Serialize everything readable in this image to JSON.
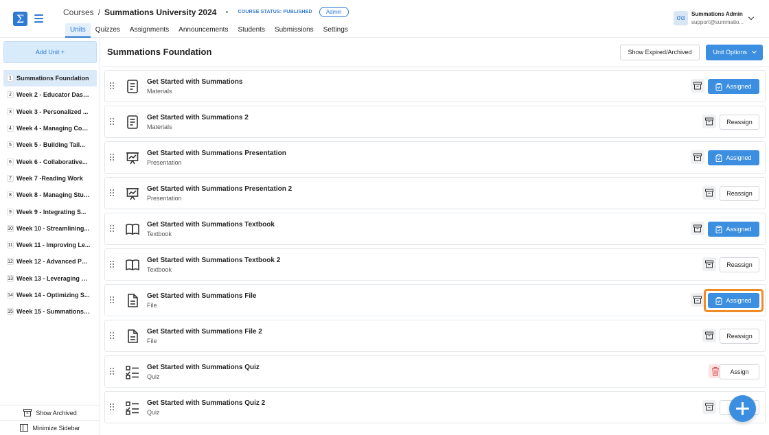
{
  "header": {
    "logo_glyph": "Σ",
    "breadcrumb_root": "Courses",
    "breadcrumb_sep": "/",
    "course_title": "Summations University 2024",
    "status": "COURSE STATUS: PUBLISHED",
    "role_badge": "Admin",
    "tabs": [
      "Units",
      "Quizzes",
      "Assignments",
      "Announcements",
      "Students",
      "Submissions",
      "Settings"
    ],
    "active_tab": "Units",
    "user": {
      "avatar": "σα",
      "name": "Summations Admin",
      "email": "support@summatio..."
    }
  },
  "sidebar": {
    "add_unit": "Add Unit +",
    "units": [
      {
        "num": "1",
        "label": "Summations Foundation"
      },
      {
        "num": "2",
        "label": "Week 2 - Educator Dash..."
      },
      {
        "num": "3",
        "label": "Week 3 - Personalized ..."
      },
      {
        "num": "4",
        "label": "Week 4 - Managing Cours..."
      },
      {
        "num": "5",
        "label": "Week 5 - Building Tail..."
      },
      {
        "num": "6",
        "label": "Week 6 - Collaborative..."
      },
      {
        "num": "7",
        "label": "Week 7 -Reading Work"
      },
      {
        "num": "8",
        "label": "Week 8 - Managing Stud..."
      },
      {
        "num": "9",
        "label": "Week 9 - Integrating S..."
      },
      {
        "num": "10",
        "label": "Week 10 - Streamlining..."
      },
      {
        "num": "11",
        "label": "Week 11 - Improving Le..."
      },
      {
        "num": "12",
        "label": "Week 12 - Advanced Per..."
      },
      {
        "num": "13",
        "label": "Week 13 - Leveraging C..."
      },
      {
        "num": "14",
        "label": "Week 14 - Optimizing S..."
      },
      {
        "num": "15",
        "label": "Week 15 - Summations i..."
      }
    ],
    "show_archived": "Show Archived",
    "minimize": "Minimize Sidebar"
  },
  "main": {
    "title": "Summations Foundation",
    "show_expired": "Show Expired/Archived",
    "unit_options": "Unit Options",
    "items": [
      {
        "title": "Get Started with Summations",
        "type": "Materials",
        "icon": "document-icon",
        "action": "Assigned"
      },
      {
        "title": "Get Started with Summations 2",
        "type": "Materials",
        "icon": "document-icon",
        "action": "Reassign"
      },
      {
        "title": "Get Started with Summations Presentation",
        "type": "Presentation",
        "icon": "presentation-icon",
        "action": "Assigned"
      },
      {
        "title": "Get Started with Summations Presentation 2",
        "type": "Presentation",
        "icon": "presentation-icon",
        "action": "Reassign"
      },
      {
        "title": "Get Started with Summations Textbook",
        "type": "Textbook",
        "icon": "book-icon",
        "action": "Assigned"
      },
      {
        "title": "Get Started with Summations Textbook 2",
        "type": "Textbook",
        "icon": "book-icon",
        "action": "Reassign"
      },
      {
        "title": "Get Started with Summations File",
        "type": "File",
        "icon": "file-icon",
        "action": "Assigned"
      },
      {
        "title": "Get Started with Summations File 2",
        "type": "File",
        "icon": "file-icon",
        "action": "Reassign"
      },
      {
        "title": "Get Started with Summations Quiz",
        "type": "Quiz",
        "icon": "quiz-icon",
        "action": "Assign"
      },
      {
        "title": "Get Started with Summations Quiz 2",
        "type": "Quiz",
        "icon": "quiz-icon",
        "action": "R"
      }
    ]
  },
  "colors": {
    "accent": "#3b8ee0",
    "highlight": "#f08a24",
    "danger_bg": "#fde3e3"
  }
}
